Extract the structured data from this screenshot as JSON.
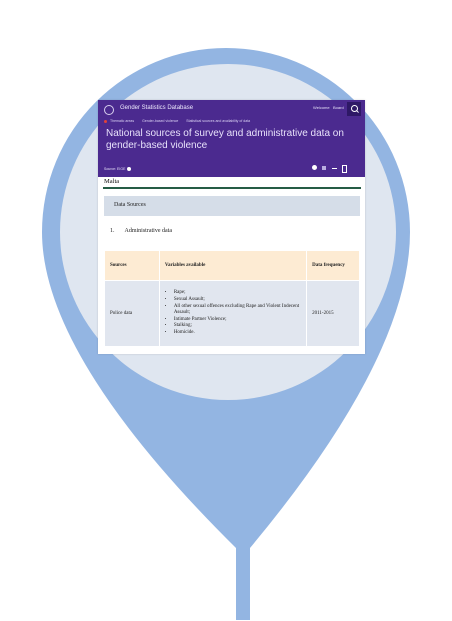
{
  "app": {
    "name": "Gender Statistics Database",
    "account": "Welcome",
    "login": "Board"
  },
  "breadcrumbs": [
    "Thematic areas",
    "Gender-based violence",
    "Statistical sources and availability of data"
  ],
  "page_title": "National sources of survey and administrative data on gender-based violence",
  "language": "Source: EIGE",
  "country": "Malta",
  "band_label": "Data Sources",
  "section": {
    "number": "1.",
    "title": "Administrative data"
  },
  "table": {
    "headers": [
      "Sources",
      "Variables available",
      "Data frequency"
    ],
    "rows": [
      {
        "source": "Police data",
        "variables": [
          "Rape;",
          "Sexual Assault;",
          "All other sexual offences excluding Rape and Violent Indecent Assault;",
          "Intimate Partner Violence;",
          "Stalking;",
          "Homicide."
        ],
        "frequency": "2011-2015"
      }
    ]
  },
  "colors": {
    "pin": "#93b5e2",
    "disc": "#dfe6f0",
    "header": "#4b2a8f",
    "table_header": "#fdebd3",
    "table_cell": "#e1e6ef"
  }
}
